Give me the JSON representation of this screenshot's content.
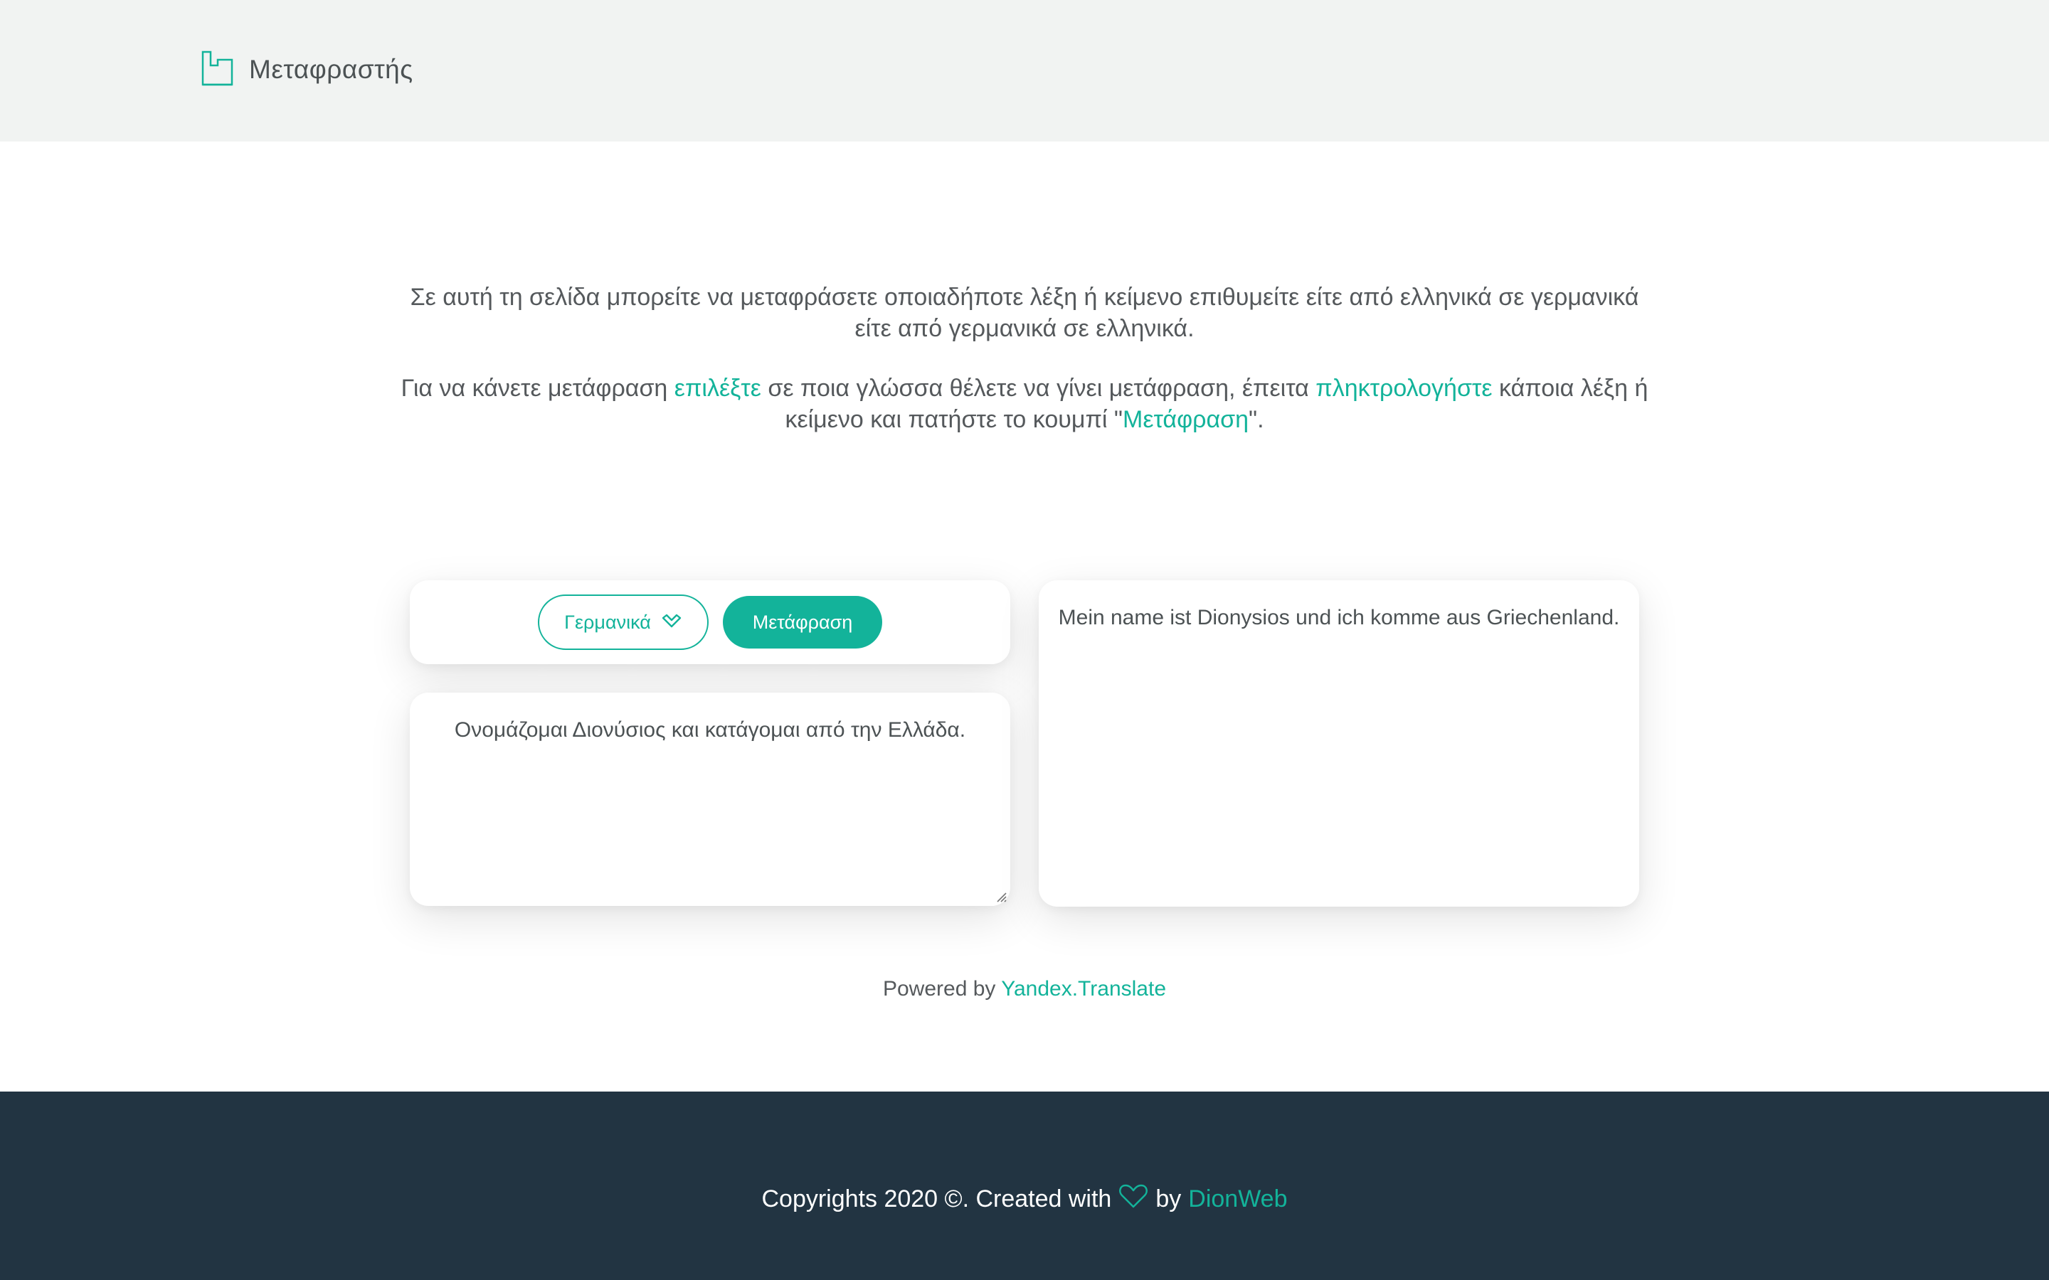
{
  "header": {
    "brand_name": "Μεταφραστής",
    "logo_icon": "house-outline-icon"
  },
  "intro": {
    "line1": "Σε αυτή τη σελίδα μπορείτε να μεταφράσετε οποιαδήποτε λέξη ή κείμενο επιθυμείτε είτε από ελληνικά σε γερμανικά είτε από γερμανικά σε ελληνικά.",
    "p2_part1": "Για να κάνετε μετάφραση ",
    "p2_accent1": "επιλέξτε",
    "p2_part2": " σε ποια γλώσσα θέλετε να γίνει μετάφραση, έπειτα ",
    "p2_accent2": "πληκτρολογήστε",
    "p2_part3": " κάποια λέξη ή κείμενο και πατήστε το κουμπί \"",
    "p2_accent3": "Μετάφραση",
    "p2_part4": "\"."
  },
  "translator": {
    "language_label": "Γερμανικά",
    "translate_button": "Μετάφραση",
    "source_text": "Ονομάζομαι Διονύσιος και κατάγομαι από την Ελλάδα.",
    "target_text": "Mein name ist Dionysios und ich komme aus Griechenland."
  },
  "powered": {
    "prefix": "Powered by ",
    "link": "Yandex.Translate"
  },
  "footer": {
    "prefix": "Copyrights 2020 ©. Created with",
    "by": "by",
    "author": "DionWeb",
    "heart_icon": "heart-outline-icon"
  },
  "colors": {
    "accent": "#13b39a",
    "header_bg": "#f1f3f2",
    "footer_bg": "#223442"
  }
}
